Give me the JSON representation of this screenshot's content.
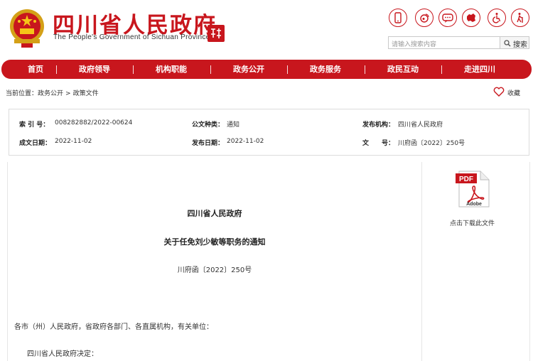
{
  "header": {
    "title": "四川省人民政府",
    "subtitle": "The People's Government of Sichuan Province",
    "seal_text": "四川省",
    "icons": [
      "mobile-icon",
      "weibo-icon",
      "wechat-icon",
      "map-icon",
      "accessibility-icon",
      "elderly-icon"
    ],
    "search_placeholder": "请输入搜索内容",
    "search_button": "搜索"
  },
  "nav": {
    "items": [
      "首页",
      "政府领导",
      "机构职能",
      "政务公开",
      "政务服务",
      "政民互动",
      "走进四川"
    ]
  },
  "breadcrumb": {
    "label": "当前位置：",
    "items": [
      "政务公开",
      "政策文件"
    ],
    "sep": ">"
  },
  "collect": {
    "label": "收藏"
  },
  "meta": {
    "index_label": "索 引 号：",
    "index_value": "008282882/2022-00624",
    "category_label": "公文种类：",
    "category_value": "通知",
    "issuer_label": "发布机构：",
    "issuer_value": "四川省人民政府",
    "created_label": "成文日期：",
    "created_value": "2022-11-02",
    "published_label": "发布日期：",
    "published_value": "2022-11-02",
    "docno_label": "文　　号：",
    "docno_value": "川府函〔2022〕250号"
  },
  "document": {
    "issuer": "四川省人民政府",
    "title": "关于任免刘少敏等职务的通知",
    "number": "川府函〔2022〕250号",
    "para1": "各市（州）人民政府，省政府各部门、各直属机构，有关单位：",
    "para2": "四川省人民政府决定："
  },
  "sidebar": {
    "pdf_text": "PDF",
    "pdf_brand": "Adobe",
    "pdf_label": "点击下载此文件"
  },
  "colors": {
    "brand_red": "#c8161d"
  }
}
